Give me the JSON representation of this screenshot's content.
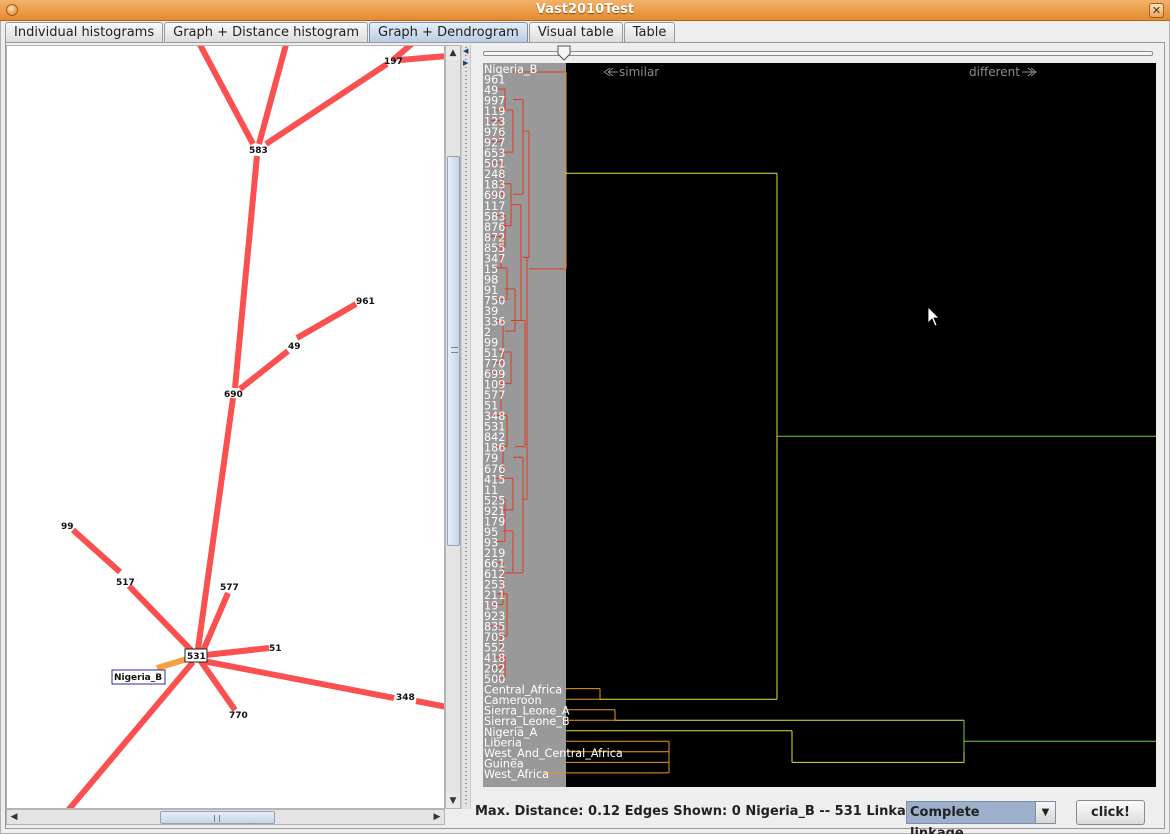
{
  "window": {
    "title": "Vast2010Test",
    "close_glyph": "✕"
  },
  "tabs": [
    {
      "label": "Individual histograms",
      "active": false
    },
    {
      "label": "Graph + Distance histogram",
      "active": false
    },
    {
      "label": "Graph + Dendrogram",
      "active": true
    },
    {
      "label": "Visual table",
      "active": false
    },
    {
      "label": "Table",
      "active": false
    }
  ],
  "graph": {
    "edge_color": "#fa5050",
    "nodes": [
      {
        "id": "197"
      },
      {
        "id": "583"
      },
      {
        "id": "961"
      },
      {
        "id": "49"
      },
      {
        "id": "690"
      },
      {
        "id": "99"
      },
      {
        "id": "517"
      },
      {
        "id": "577"
      },
      {
        "id": "531"
      },
      {
        "id": "51"
      },
      {
        "id": "Nigeria_B"
      },
      {
        "id": "348"
      },
      {
        "id": "770"
      }
    ]
  },
  "dendrogram": {
    "similar_label": "similar",
    "different_label": "different",
    "background": "#000000",
    "label_column_color": "#999999",
    "line_colors": {
      "red": "#e03c20",
      "orange": "#e89a1c",
      "yellow": "#e2e23c",
      "green": "#70d040"
    },
    "leaves": [
      "Nigeria_B",
      "961",
      "49",
      "997",
      "119",
      "123",
      "976",
      "927",
      "653",
      "501",
      "248",
      "183",
      "690",
      "117",
      "583",
      "876",
      "872",
      "855",
      "347",
      "15",
      "98",
      "91",
      "750",
      "39",
      "336",
      "2",
      "99",
      "517",
      "770",
      "699",
      "109",
      "577",
      "51",
      "348",
      "531",
      "842",
      "186",
      "79",
      "676",
      "415",
      "11",
      "525",
      "921",
      "179",
      "95",
      "93",
      "219",
      "661",
      "612",
      "253",
      "211",
      "19",
      "923",
      "835",
      "705",
      "552",
      "418",
      "202",
      "500",
      "Central_Africa",
      "Cameroon",
      "Sierra_Leone_A",
      "Sierra_Leone_B",
      "Nigeria_A",
      "Liberia",
      "West_And_Central_Africa",
      "Guinea",
      "West_Africa"
    ]
  },
  "status": {
    "max_distance": "Max. Distance: 0.12",
    "edges_shown": "Edges Shown: 0",
    "selection": "Nigeria_B -- 531",
    "linkage_label": "Linkage",
    "linkage_value": "Complete linkage",
    "click_button": "click!"
  }
}
